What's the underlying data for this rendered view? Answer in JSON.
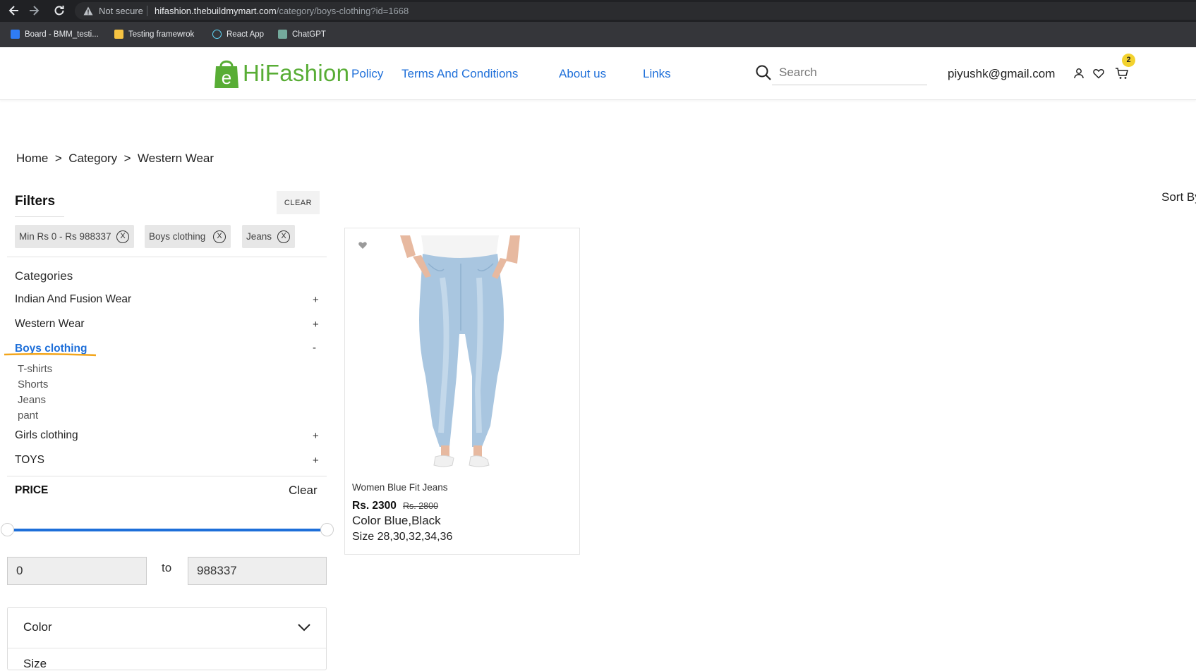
{
  "browser": {
    "not_secure": "Not secure",
    "url_host": "hifashion.thebuildmymart.com",
    "url_path": "/category/boys-clothing?id=1668",
    "bookmarks": [
      {
        "label": "Board - BMM_testi...",
        "color": "#2f7cf6"
      },
      {
        "label": "Testing framewrok",
        "color": "#f6c342"
      },
      {
        "label": "React App",
        "color": "#61dafb"
      },
      {
        "label": "ChatGPT",
        "color": "#74aa9c"
      }
    ]
  },
  "header": {
    "logo_text": "HiFashion",
    "nav": [
      "Policy",
      "Terms And Conditions",
      "About us",
      "Links"
    ],
    "search_placeholder": "Search",
    "user_email": "piyushk@gmail.com",
    "cart_count": "2",
    "brand_color": "#58ad35",
    "link_color": "#1e6fd9"
  },
  "breadcrumb": [
    "Home",
    "Category",
    "Western Wear"
  ],
  "filters": {
    "title": "Filters",
    "clear_label": "CLEAR",
    "chips": [
      "Min Rs 0 - Rs 988337",
      "Boys clothing",
      "Jeans"
    ],
    "chip_close": "X",
    "categories_heading": "Categories",
    "categories": [
      {
        "label": "Indian And Fusion Wear",
        "toggle": "+"
      },
      {
        "label": "Western Wear",
        "toggle": "+"
      },
      {
        "label": "Boys clothing",
        "toggle": "-",
        "active": true
      },
      {
        "label": "Girls clothing",
        "toggle": "+"
      },
      {
        "label": "TOYS",
        "toggle": "+"
      }
    ],
    "boys_subcategories": [
      "T-shirts",
      "Shorts",
      "Jeans",
      "pant"
    ],
    "price": {
      "title": "PRICE",
      "clear_label": "Clear",
      "min": "0",
      "max": "988337",
      "to_label": "to"
    },
    "color_label": "Color",
    "size_label": "Size"
  },
  "sort_label": "Sort By",
  "products": [
    {
      "name": "Women Blue Fit Jeans",
      "price": "Rs. 2300",
      "mrp": "Rs. 2800",
      "color": "Color Blue,Black",
      "size": "Size 28,30,32,34,36"
    }
  ]
}
